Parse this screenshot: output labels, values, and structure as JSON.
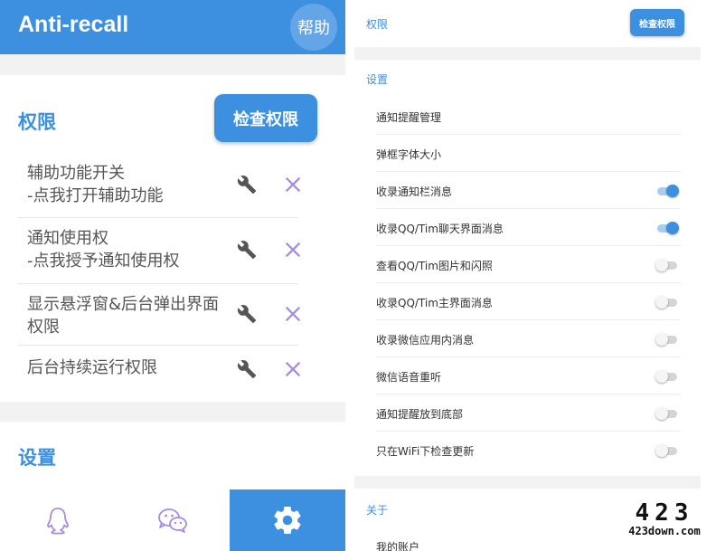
{
  "left": {
    "app_title": "Anti-recall",
    "help_label": "帮助",
    "permissions": {
      "title": "权限",
      "check_button": "检查权限",
      "items": [
        {
          "label": "辅助功能开关\n-点我打开辅助功能"
        },
        {
          "label": "通知使用权\n-点我授予通知使用权"
        },
        {
          "label": "显示悬浮窗&后台弹出界面权限"
        },
        {
          "label": "后台持续运行权限"
        }
      ]
    },
    "settings_title": "设置",
    "nav": [
      "qq-icon",
      "wechat-icon",
      "gear-icon"
    ]
  },
  "right": {
    "permissions_title": "权限",
    "check_button": "检查权限",
    "settings_title": "设置",
    "settings": [
      {
        "label": "通知提醒管理"
      },
      {
        "label": "弹框字体大小"
      },
      {
        "label": "收录通知栏消息",
        "on": true
      },
      {
        "label": "收录QQ/Tim聊天界面消息",
        "on": true
      },
      {
        "label": "查看QQ/Tim图片和闪照",
        "on": false
      },
      {
        "label": "收录QQ/Tim主界面消息",
        "on": false
      },
      {
        "label": "收录微信应用内消息",
        "on": false
      },
      {
        "label": "微信语音重听",
        "on": false
      },
      {
        "label": "通知提醒放到底部",
        "on": false
      },
      {
        "label": "只在WiFi下检查更新",
        "on": false
      }
    ],
    "about_title": "关于",
    "my_account": "我的账户"
  },
  "watermark": {
    "big": "423",
    "small": "423down.com"
  },
  "colors": {
    "accent": "#3d8fe0",
    "x_mark": "#a78bdf",
    "icon_gray": "#555555"
  }
}
